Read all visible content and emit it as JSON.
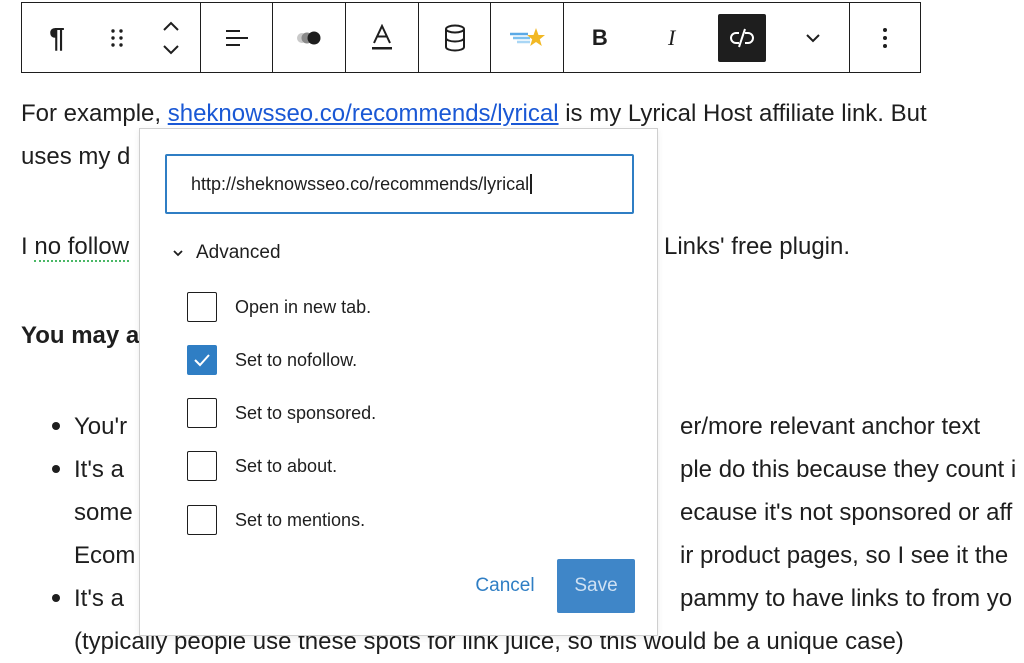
{
  "toolbar": {
    "paragraph_glyph": "¶",
    "bold_label": "B",
    "italic_label": "I",
    "icons": [
      "paragraph-icon",
      "drag-handle-icon",
      "move-up-icon",
      "move-down-icon",
      "align-icon",
      "highlight-icon",
      "text-color-icon",
      "database-icon",
      "plugin-star-icon",
      "bold-icon",
      "italic-icon",
      "unlink-icon",
      "chevron-down-icon",
      "more-options-icon"
    ]
  },
  "document": {
    "p1_prefix": "For example, ",
    "p1_link": "sheknowsseo.co/recommends/lyrical",
    "p1_suffix": " is my Lyrical Host affiliate link. But",
    "p1b": "uses my d",
    "p2_prefix": "I ",
    "p2_dotted": "no follow",
    "p2_suffix": " Links' free plugin.",
    "p3": "You may a",
    "bullet1_left": "You'r",
    "bullet1_right": "er/more relevant anchor text",
    "bullet2_left": "It's a",
    "bullet2_right": "ple do this because they count i",
    "bullet2b_left": "some",
    "bullet2b_right": "ecause it's not sponsored or aff",
    "bullet2c_left": "Ecom",
    "bullet2c_right": "ir product pages, so I see it the",
    "bullet3_left": "It's a",
    "bullet3_right": "pammy to have links to from yo",
    "bullet3b": "(typically people use these spots for link juice, so this would be a unique case)"
  },
  "popover": {
    "url_value": "http://sheknowsseo.co/recommends/lyrical",
    "advanced_label": "Advanced",
    "options": [
      {
        "label": "Open in new tab.",
        "checked": false
      },
      {
        "label": "Set to nofollow.",
        "checked": true
      },
      {
        "label": "Set to sponsored.",
        "checked": false
      },
      {
        "label": "Set to about.",
        "checked": false
      },
      {
        "label": "Set to mentions.",
        "checked": false
      }
    ],
    "cancel_label": "Cancel",
    "save_label": "Save"
  },
  "colors": {
    "accent": "#2f7ec4",
    "link": "#1a58d5",
    "save_button": "#3f86c8",
    "dotted_underline": "#4ab866",
    "text": "#1e1e1e"
  }
}
